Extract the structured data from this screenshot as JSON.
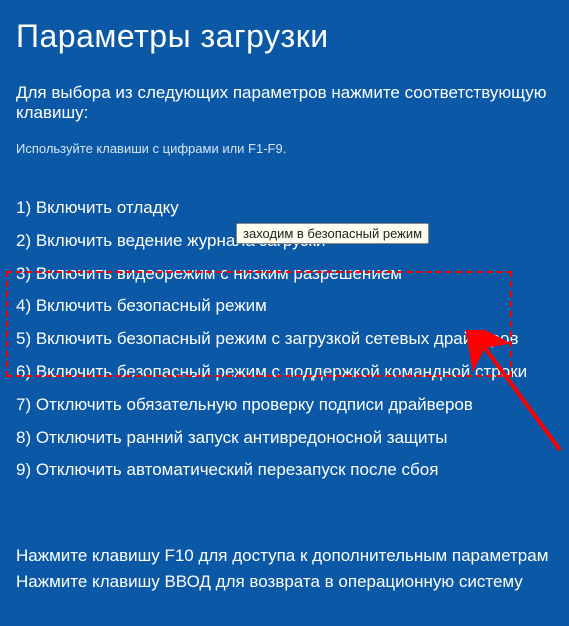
{
  "title": "Параметры загрузки",
  "subtitle": "Для выбора из следующих параметров нажмите соответствующую клавишу:",
  "hint": "Используйте клавиши с цифрами или F1-F9.",
  "options": [
    "1) Включить отладку",
    "2) Включить ведение журнала загрузки",
    "3) Включить видеорежим с низким разрешением",
    "4) Включить безопасный режим",
    "5) Включить безопасный режим с загрузкой сетевых драйверов",
    "6) Включить безопасный режим с поддержкой командной строки",
    "7) Отключить обязательную проверку подписи драйверов",
    "8) Отключить ранний запуск антивредоносной защиты",
    "9) Отключить автоматический перезапуск после сбоя"
  ],
  "footer": {
    "line1": "Нажмите клавишу F10 для доступа к дополнительным параметрам",
    "line2": "Нажмите клавишу ВВОД для возврата в операционную систему"
  },
  "tooltip_text": "заходим в безопасный режим",
  "annotation": {
    "highlight_color": "#ff0000",
    "arrow_color": "#ff0000"
  }
}
